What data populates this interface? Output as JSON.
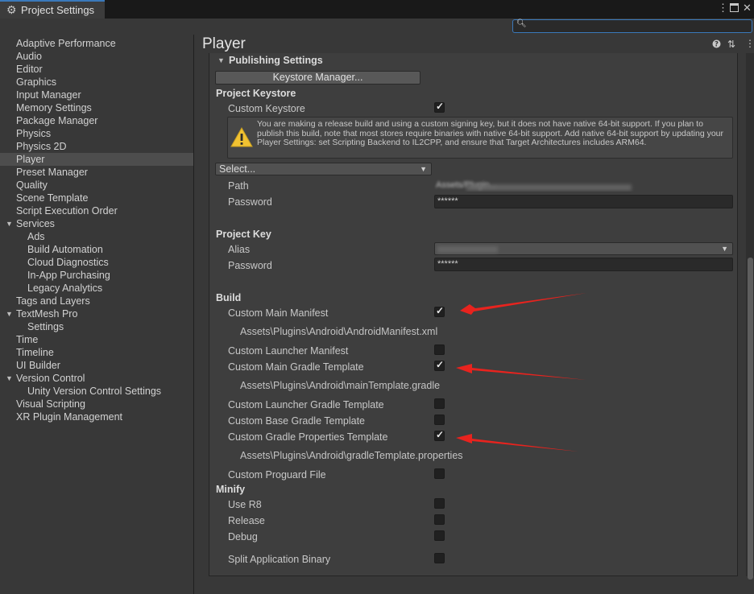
{
  "window": {
    "tab_title": "Project Settings",
    "tab_icon": "gear-icon",
    "menu_icon": "kebab-menu-icon",
    "maximize_icon": "maximize-icon",
    "close_icon": "close-icon"
  },
  "search": {
    "value": "",
    "placeholder": ""
  },
  "sidebar": {
    "items": [
      {
        "label": "Adaptive Performance",
        "indent": 0
      },
      {
        "label": "Audio",
        "indent": 0
      },
      {
        "label": "Editor",
        "indent": 0
      },
      {
        "label": "Graphics",
        "indent": 0
      },
      {
        "label": "Input Manager",
        "indent": 0
      },
      {
        "label": "Memory Settings",
        "indent": 0
      },
      {
        "label": "Package Manager",
        "indent": 0
      },
      {
        "label": "Physics",
        "indent": 0
      },
      {
        "label": "Physics 2D",
        "indent": 0
      },
      {
        "label": "Player",
        "indent": 0,
        "selected": true
      },
      {
        "label": "Preset Manager",
        "indent": 0
      },
      {
        "label": "Quality",
        "indent": 0
      },
      {
        "label": "Scene Template",
        "indent": 0
      },
      {
        "label": "Script Execution Order",
        "indent": 0
      },
      {
        "label": "Services",
        "indent": 0,
        "expanded": true
      },
      {
        "label": "Ads",
        "indent": 1
      },
      {
        "label": "Build Automation",
        "indent": 1
      },
      {
        "label": "Cloud Diagnostics",
        "indent": 1
      },
      {
        "label": "In-App Purchasing",
        "indent": 1
      },
      {
        "label": "Legacy Analytics",
        "indent": 1
      },
      {
        "label": "Tags and Layers",
        "indent": 0
      },
      {
        "label": "TextMesh Pro",
        "indent": 0,
        "expanded": true
      },
      {
        "label": "Settings",
        "indent": 1
      },
      {
        "label": "Time",
        "indent": 0
      },
      {
        "label": "Timeline",
        "indent": 0
      },
      {
        "label": "UI Builder",
        "indent": 0
      },
      {
        "label": "Version Control",
        "indent": 0,
        "expanded": true
      },
      {
        "label": "Unity Version Control Settings",
        "indent": 1
      },
      {
        "label": "Visual Scripting",
        "indent": 0
      },
      {
        "label": "XR Plugin Management",
        "indent": 0
      }
    ]
  },
  "main": {
    "title": "Player",
    "header_icons": [
      "help-icon",
      "preset-icon",
      "kebab-menu-icon"
    ],
    "publishing": {
      "section_label": "Publishing Settings",
      "keystore_button": "Keystore Manager...",
      "project_keystore": {
        "heading": "Project Keystore",
        "custom_keystore_label": "Custom Keystore",
        "custom_keystore_checked": true,
        "warning": "You are making a release build and using a custom signing key, but it does not have native 64-bit support. If you plan to publish this build, note that most stores require binaries with native 64-bit support. Add native 64-bit support by updating your Player Settings: set Scripting Backend to IL2CPP, and ensure that Target Architectures includes ARM64.",
        "select_label": "Select...",
        "path_label": "Path",
        "path_value": "Assets/Plugin...",
        "password_label": "Password",
        "password_value": "******"
      },
      "project_key": {
        "heading": "Project Key",
        "alias_label": "Alias",
        "password_label": "Password",
        "password_value": "******"
      },
      "build": {
        "heading": "Build",
        "items": [
          {
            "label": "Custom Main Manifest",
            "checked": true,
            "path": "Assets\\Plugins\\Android\\AndroidManifest.xml"
          },
          {
            "label": "Custom Launcher Manifest",
            "checked": false
          },
          {
            "label": "Custom Main Gradle Template",
            "checked": true,
            "path": "Assets\\Plugins\\Android\\mainTemplate.gradle"
          },
          {
            "label": "Custom Launcher Gradle Template",
            "checked": false
          },
          {
            "label": "Custom Base Gradle Template",
            "checked": false
          },
          {
            "label": "Custom Gradle Properties Template",
            "checked": true,
            "path": "Assets\\Plugins\\Android\\gradleTemplate.properties"
          },
          {
            "label": "Custom Proguard File",
            "checked": false
          }
        ]
      },
      "minify": {
        "heading": "Minify",
        "items": [
          {
            "label": "Use R8",
            "checked": false
          },
          {
            "label": "Release",
            "checked": false
          },
          {
            "label": "Debug",
            "checked": false
          }
        ]
      },
      "split_binary": {
        "label": "Split Application Binary",
        "checked": false
      }
    }
  },
  "annotation_color": "#e8231e"
}
